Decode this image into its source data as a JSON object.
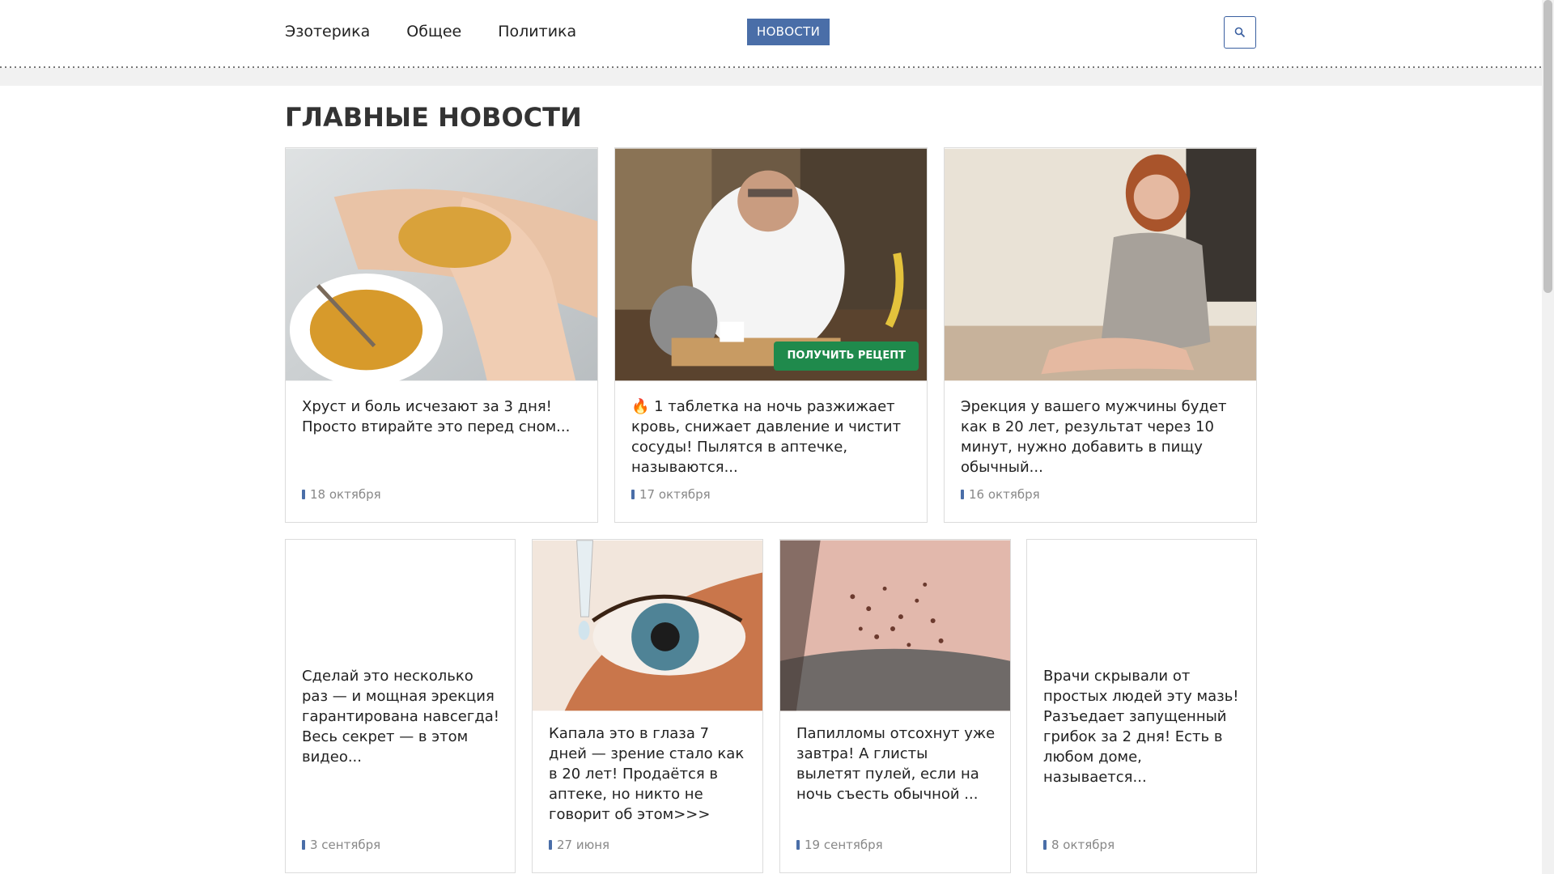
{
  "nav": {
    "items": [
      "Эзотерика",
      "Общее",
      "Политика"
    ],
    "badge": "НОВОСТИ"
  },
  "section": {
    "title": "ГЛАВНЫЕ НОВОСТИ"
  },
  "cards": [
    {
      "title": "Хруст и боль исчезают за 3 дня! Просто втирайте это перед сном...",
      "date": "18 октября"
    },
    {
      "title": "🔥 1 таблетка на ночь разжижает кровь, снижает давление и чистит сосуды! Пылятся в аптечке, называются...",
      "date": "17 октября",
      "button": "ПОЛУЧИТЬ РЕЦЕПТ"
    },
    {
      "title": "Эрекция у вашего мужчины будет как в 20 лет, результат через 10 минут, нужно добавить в пищу обычный...",
      "date": "16 октября"
    },
    {
      "title": "Сделай это несколько раз — и мощная эрекция гарантирована навсегда! Весь секрет — в этом видео...",
      "date": "3 сентября"
    },
    {
      "title": "Капала это в глаза 7 дней — зрение стало как в 20 лет! Продаётся в аптеке, но никто не говорит об этом>>>",
      "date": "27 июня"
    },
    {
      "title": "Папилломы отсохнут уже завтра! А глисты вылетят пулей, если на ночь съесть обычной ...",
      "date": "19 сентября"
    },
    {
      "title": "Врачи скрывали от простых людей эту мазь! Разъедает запущенный грибок за 2 дня! Есть в любом доме, называется...",
      "date": "8 октября"
    }
  ],
  "colors": {
    "accent": "#4a6ea8",
    "recipe_button": "#1f8a4c"
  },
  "icons": {
    "search": "search-icon",
    "date": "clock-icon"
  }
}
